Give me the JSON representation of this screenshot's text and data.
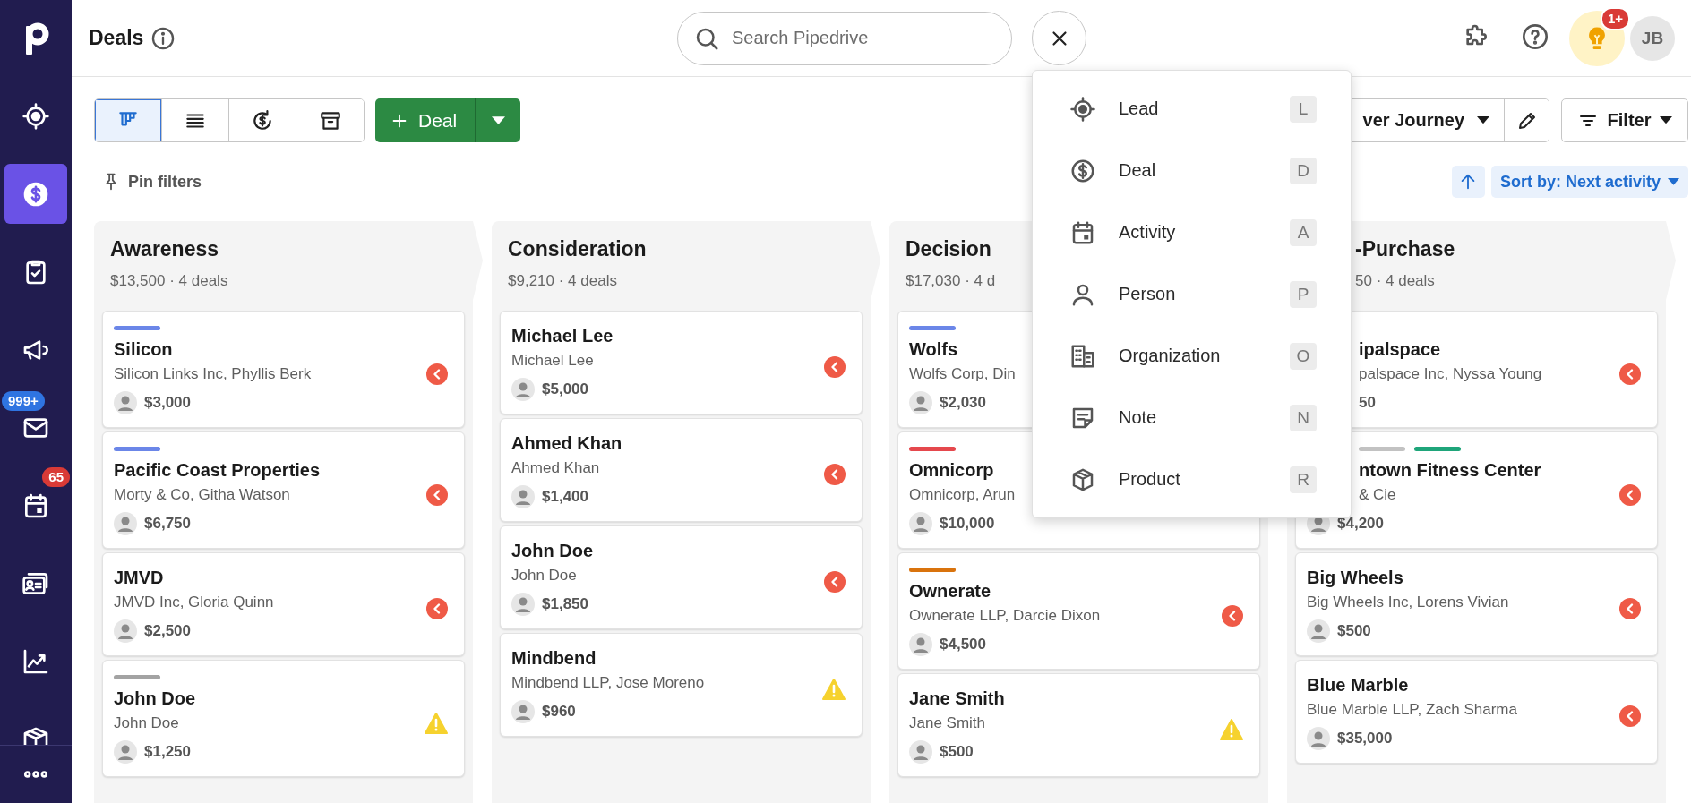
{
  "sidebar": {
    "items": [
      {
        "selected": false
      },
      {
        "selected": true
      },
      {
        "selected": false
      },
      {
        "selected": false
      },
      {
        "selected": false,
        "badge": {
          "text": "999+",
          "color": "#2f74e1"
        }
      },
      {
        "selected": false,
        "badge": {
          "text": "65",
          "color": "#d93a36"
        }
      },
      {
        "selected": false
      },
      {
        "selected": false
      },
      {
        "selected": false
      },
      {
        "selected": false
      }
    ]
  },
  "header": {
    "title": "Deals",
    "search": {
      "placeholder": "Search Pipedrive"
    },
    "notification_badge": "1+",
    "avatar": "JB"
  },
  "toolbar": {
    "views": [
      {
        "selected": true
      },
      {
        "selected": false
      },
      {
        "selected": false
      },
      {
        "selected": false
      }
    ],
    "add_button": "Deal",
    "pipeline": "ver Journey",
    "filter": "Filter",
    "pin_filters": "Pin filters",
    "sort": "Sort by: Next activity"
  },
  "columns": [
    {
      "title": "Awareness",
      "summary": "$13,500 · 4 deals",
      "deals": [
        {
          "title": "Silicon",
          "subtitle": "Silicon Links Inc, Phyllis Berk",
          "amount": "$3,000",
          "kind": "overdue",
          "labels": [
            {
              "color": "#6b86e8"
            }
          ]
        },
        {
          "title": "Pacific Coast Properties",
          "subtitle": "Morty & Co, Githa Watson",
          "amount": "$6,750",
          "kind": "overdue",
          "labels": [
            {
              "color": "#6b86e8"
            }
          ]
        },
        {
          "title": "JMVD",
          "subtitle": "JMVD Inc, Gloria Quinn",
          "amount": "$2,500",
          "kind": "overdue"
        },
        {
          "title": "John Doe",
          "subtitle": "John Doe",
          "amount": "$1,250",
          "kind": "warning",
          "labels": [
            {
              "color": "#a3a3a3"
            }
          ]
        }
      ]
    },
    {
      "title": "Consideration",
      "summary": "$9,210 · 4 deals",
      "deals": [
        {
          "title": "Michael Lee",
          "subtitle": "Michael Lee",
          "amount": "$5,000",
          "kind": "overdue"
        },
        {
          "title": "Ahmed Khan",
          "subtitle": "Ahmed Khan",
          "amount": "$1,400",
          "kind": "overdue"
        },
        {
          "title": "John Doe",
          "subtitle": "John Doe",
          "amount": "$1,850",
          "kind": "overdue"
        },
        {
          "title": "Mindbend",
          "subtitle": "Mindbend LLP, Jose Moreno",
          "amount": "$960",
          "kind": "warning"
        }
      ]
    },
    {
      "title": "Decision",
      "summary": "$17,030 · 4 d",
      "deals": [
        {
          "title": "Wolfs",
          "subtitle": "Wolfs Corp, Din",
          "amount": "$2,030",
          "labels": [
            {
              "color": "#6b86e8"
            }
          ]
        },
        {
          "title": "Omnicorp",
          "subtitle": "Omnicorp, Arun",
          "amount": "$10,000",
          "labels": [
            {
              "color": "#e5484d"
            }
          ]
        },
        {
          "title": "Ownerate",
          "subtitle": "Ownerate LLP, Darcie Dixon",
          "amount": "$4,500",
          "kind": "overdue",
          "labels": [
            {
              "color": "#d9730d"
            }
          ]
        },
        {
          "title": "Jane Smith",
          "subtitle": "Jane Smith",
          "amount": "$500",
          "kind": "warning"
        }
      ]
    },
    {
      "title": "-Purchase",
      "summary": "50 · 4 deals",
      "covered": true,
      "deals": [
        {
          "title": "ipalspace",
          "subtitle": "palspace Inc, Nyssa Young",
          "amount": "50",
          "kind": "overdue",
          "covered": true,
          "avatar_hidden": true
        },
        {
          "title": "ntown Fitness Center",
          "subtitle": "& Cie",
          "amount": "$4,200",
          "kind": "overdue",
          "covered": true,
          "labels": [
            {
              "color": "#c2c2c2"
            },
            {
              "color": "#1fa57a"
            }
          ]
        },
        {
          "title": "Big Wheels",
          "subtitle": "Big Wheels Inc, Lorens Vivian",
          "amount": "$500",
          "kind": "overdue"
        },
        {
          "title": "Blue Marble",
          "subtitle": "Blue Marble LLP, Zach Sharma",
          "amount": "$35,000",
          "kind": "overdue"
        }
      ]
    }
  ],
  "add_menu": {
    "items": [
      {
        "label": "Lead",
        "shortcut": "L"
      },
      {
        "label": "Deal",
        "shortcut": "D"
      },
      {
        "label": "Activity",
        "shortcut": "A"
      },
      {
        "label": "Person",
        "shortcut": "P"
      },
      {
        "label": "Organization",
        "shortcut": "O"
      },
      {
        "label": "Note",
        "shortcut": "N"
      },
      {
        "label": "Product",
        "shortcut": "R"
      }
    ]
  }
}
